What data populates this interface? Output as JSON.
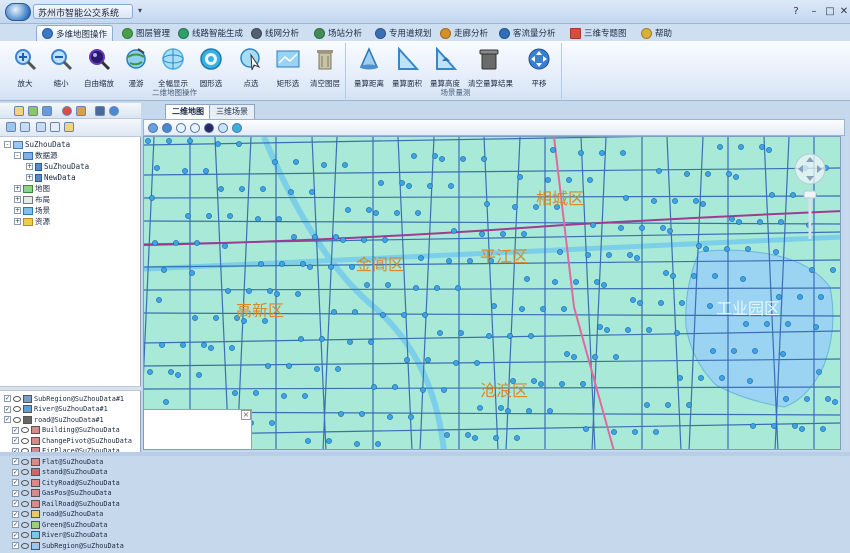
{
  "window": {
    "title": "苏州市智能公交系统",
    "minimize": "–",
    "restore": "□",
    "close": "✕",
    "help": "?",
    "qat_arrow": "▾"
  },
  "tabs": [
    {
      "label": "多维地图操作",
      "color": "#3a78c8",
      "active": true
    },
    {
      "label": "图层管理",
      "color": "#4aa04a"
    },
    {
      "label": "线路智能生成",
      "color": "#2f9e6a"
    },
    {
      "label": "线网分析",
      "color": "#555e6e"
    },
    {
      "label": "场站分析",
      "color": "#3f8f55"
    },
    {
      "label": "专用道规划",
      "color": "#3b6fb5"
    },
    {
      "label": "走廊分析",
      "color": "#d3902a"
    },
    {
      "label": "客流量分析",
      "color": "#2e6fb9"
    },
    {
      "label": "三维专题图",
      "color": "#d74c3d"
    },
    {
      "label": "帮助",
      "color": "#d8b03a"
    }
  ],
  "ribbon": {
    "group1": {
      "label": "二维地图操作",
      "buttons": [
        {
          "label": "放大",
          "icon": "zoom-in-icon",
          "color": "#3b82d6"
        },
        {
          "label": "缩小",
          "icon": "zoom-out-icon",
          "color": "#3b82d6"
        },
        {
          "label": "自由缩放",
          "icon": "free-zoom-icon",
          "color": "#6a36b8"
        },
        {
          "label": "漫游",
          "icon": "pan-globe-icon",
          "color": "#3aa0d8"
        },
        {
          "label": "全幅显示",
          "icon": "full-extent-icon",
          "color": "#4bb3e8"
        },
        {
          "label": "圆形选",
          "icon": "circle-select-icon",
          "color": "#2da5d6"
        },
        {
          "label": "点选",
          "icon": "point-select-icon",
          "color": "#4db0d8"
        },
        {
          "label": "矩形选",
          "icon": "rectangle-select-icon",
          "color": "#3fa8e0"
        },
        {
          "label": "清空图层",
          "icon": "clear-layer-icon",
          "color": "#8e8e7a"
        }
      ]
    },
    "group2": {
      "label": "场景量测",
      "buttons": [
        {
          "label": "量算距离",
          "icon": "measure-distance-icon",
          "color": "#4a90d0"
        },
        {
          "label": "量算面积",
          "icon": "measure-area-icon",
          "color": "#3a85c8"
        },
        {
          "label": "量算高度",
          "icon": "measure-height-icon",
          "color": "#3a85c8"
        },
        {
          "label": "清空量算结果",
          "icon": "clear-measure-icon",
          "color": "#5a5a5a"
        },
        {
          "label": "平移",
          "icon": "pan-arrows-icon",
          "color": "#3b7fd0"
        }
      ]
    }
  },
  "tree": {
    "root": "SuZhouData",
    "nodes": [
      {
        "label": "数据源",
        "indent": 1
      },
      {
        "label": "SuZhouData",
        "indent": 2,
        "mono": true
      },
      {
        "label": "NewData",
        "indent": 2,
        "mono": true
      },
      {
        "label": "地图",
        "indent": 1
      },
      {
        "label": "布局",
        "indent": 1
      },
      {
        "label": "场景",
        "indent": 1
      },
      {
        "label": "资源",
        "indent": 1
      }
    ]
  },
  "layers": [
    "SubRegion@SuZhouData#1",
    "River@SuZhouData#1",
    "road@SuZhouData#1",
    "Building@SuZhouData",
    "ChangePivot@SuZhouData",
    "FirPlace@SuZhouData",
    "Flat@SuZhouData",
    "stand@SuZhouData",
    "CityRoad@SuZhouData",
    "GasPos@SuZhouData",
    "RailRoad@SuZhouData",
    "road@SuZhouData",
    "Green@SuZhouData",
    "River@SuZhouData",
    "SubRegion@SuZhouData"
  ],
  "map": {
    "tabs": [
      "二维地图",
      "三维场景"
    ],
    "districts": [
      {
        "label": "相城区"
      },
      {
        "label": "金阊区"
      },
      {
        "label": "平江区"
      },
      {
        "label": "高新区"
      },
      {
        "label": "工业园区"
      },
      {
        "label": "沧浪区"
      }
    ]
  }
}
